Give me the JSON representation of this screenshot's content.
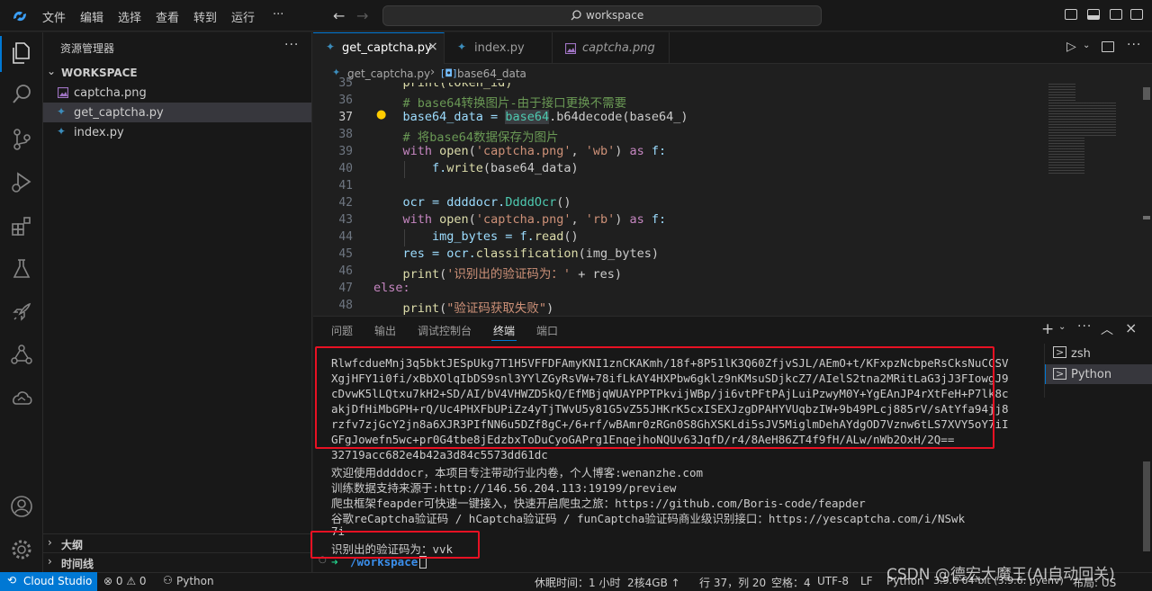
{
  "menu": [
    "文件",
    "编辑",
    "选择",
    "查看",
    "转到",
    "运行",
    "···"
  ],
  "search": {
    "text": "workspace"
  },
  "sidebar": {
    "title": "资源管理器",
    "more": "···",
    "workspace": "WORKSPACE",
    "files": [
      "captcha.png",
      "get_captcha.py",
      "index.py"
    ],
    "outline": "大纲",
    "timeline": "时间线"
  },
  "tabs": [
    "get_captcha.py",
    "index.py",
    "captcha.png"
  ],
  "breadcrumb": {
    "file": "get_captcha.py",
    "symbol": "base64_data"
  },
  "editor": {
    "line_numbers": [
      "35",
      "36",
      "37",
      "38",
      "39",
      "40",
      "41",
      "42",
      "43",
      "44",
      "45",
      "46",
      "47",
      "48"
    ],
    "lines": {
      "l35": "    print(token_id)",
      "l36": "    # base64转换图片-由于接口更换不需要",
      "l37a": "    base64_data = ",
      "l37b": "base64",
      "l37c": ".b64decode(base64_)",
      "l38": "    # 将base64数据保存为图片",
      "l39a": "    with ",
      "l39b": "open",
      "l39c": "(",
      "l39d": "'captcha.png'",
      "l39e": ", ",
      "l39f": "'wb'",
      "l39g": ") ",
      "l39h": "as",
      "l39i": " f:",
      "l40a": "        f.",
      "l40b": "write",
      "l40c": "(base64_data)",
      "l42a": "    ocr = ddddocr.",
      "l42b": "DdddOcr",
      "l42c": "()",
      "l43a": "    with ",
      "l43b": "open",
      "l43c": "(",
      "l43d": "'captcha.png'",
      "l43e": ", ",
      "l43f": "'rb'",
      "l43g": ") ",
      "l43h": "as",
      "l43i": " f:",
      "l44a": "        img_bytes = f.",
      "l44b": "read",
      "l44c": "()",
      "l45a": "    res = ocr.",
      "l45b": "classification",
      "l45c": "(img_bytes)",
      "l46a": "    ",
      "l46b": "print",
      "l46c": "(",
      "l46d": "'识别出的验证码为：'",
      "l46e": " + res)",
      "l47": "else:",
      "l48a": "    ",
      "l48b": "print",
      "l48c": "(",
      "l48d": "\"验证码获取失败\"",
      "l48e": ")"
    }
  },
  "panel": {
    "tabs": [
      "问题",
      "输出",
      "调试控制台",
      "终端",
      "端口"
    ],
    "terminal_lines": [
      "RlwfcdueMnj3q5bktJESpUkg7T1H5VFFDFAmyKNI1znCKAKmh/18f+8P51lK3Q60ZfjvSJL/AEmO+t/KFxpzNcbpeRsCksNuCCSV",
      "XgjHFY1i0fi/xBbXOlqIbDS9snl3YYlZGyRsVW+78ifLkAY4HXPbw6gklz9nKMsuSDjkcZ7/AIelS2tna2MRitLaG3jJ3FIowgJ9",
      "cDvwK5lLQtxu7kH2+SD/AI/bV4VHWZD5kQ/EfMBjqWUAYPPTPkvijWBp/ji6vtPFtPAjLuiPzwyM0Y+YgEAnJP4rXtFeH+P7lk8c",
      "akjDfHiMbGPH+rQ/Uc4PHXFbUPiZz4yTjTWvU5y81G5vZ55JHKrK5cxISEXJzgDPAHYVUqbzIW+9b49PLcj885rV/sAtYfa94jj8",
      "rzfv7zjGcY2jn8a6XJR3PIfNN6u5DZf8gC+/6+rf/wBAmr0zRGn0S8GhXSKLdi5sJV5MiglmDehAYdgOD7Vznw6tLS7XVY5oY7iI",
      "GFgJowefn5wc+pr0G4tbe8jEdzbxToDuCyoGAPrg1EnqejhoNQUv63JqfD/r4/8AeH86ZT4f9fH/ALw/nWb2OxH/2Q==",
      "32719acc682e4b42a3d84c5573dd61dc",
      "欢迎使用ddddocr，本项目专注带动行业内卷，个人博客:wenanzhe.com",
      "训练数据支持来源于:http://146.56.204.113:19199/preview",
      "爬虫框架feapder可快速一键接入，快速开启爬虫之旅：https://github.com/Boris-code/feapder",
      "谷歌reCaptcha验证码 / hCaptcha验证码 / funCaptcha验证码商业级识别接口：https://yescaptcha.com/i/NSwk",
      "7i",
      "识别出的验证码为：vvk"
    ],
    "prompt": "/workspace",
    "terminals": [
      "zsh",
      "Python"
    ]
  },
  "statusbar": {
    "remote": "Cloud Studio",
    "problems": "⊗ 0 ⚠ 0",
    "python": "Python",
    "rest": "休眠时间：1 小时",
    "cpu": "2核4GB ↑",
    "pos": "行 37，列 20",
    "spaces": "空格：4",
    "enc": "UTF-8",
    "eol": "LF",
    "lang": "Python",
    "interp": "3.9.6 64-bit (3.9.6: pyenv)",
    "layout": "布局: US"
  },
  "watermark": "CSDN @德宏大魔王(AI自动回关)"
}
